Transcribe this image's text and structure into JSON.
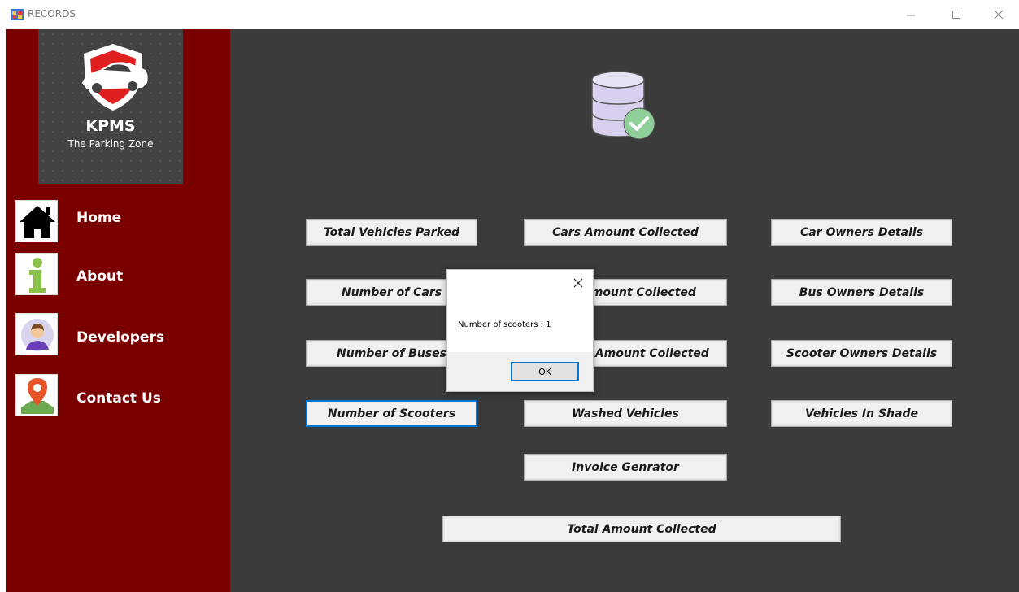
{
  "window": {
    "title": "RECORDS"
  },
  "logo": {
    "title": "KPMS",
    "subtitle": "The Parking Zone"
  },
  "nav": {
    "items": [
      {
        "label": "Home",
        "icon": "home-icon"
      },
      {
        "label": "About",
        "icon": "info-icon"
      },
      {
        "label": "Developers",
        "icon": "developer-avatar-icon"
      },
      {
        "label": "Contact Us",
        "icon": "location-pin-icon"
      }
    ]
  },
  "buttons": {
    "total_vehicles_parked": "Total Vehicles Parked",
    "cars_amount_collected": "Cars Amount Collected",
    "car_owners_details": "Car Owners Details",
    "number_of_cars": "Number of Cars",
    "bus_amount_collected": "Bus Amount Collected",
    "bus_owners_details": "Bus Owners Details",
    "number_of_buses": "Number of Buses",
    "scooter_amount_collected": "Scooter Amount Collected",
    "scooter_owners_details": "Scooter Owners Details",
    "number_of_scooters": "Number of Scooters",
    "washed_vehicles": "Washed Vehicles",
    "vehicles_in_shade": "Vehicles In Shade",
    "invoice_generator": "Invoice Genrator",
    "total_amount_collected": "Total Amount Collected"
  },
  "dialog": {
    "message": "Number of scooters : 1",
    "ok_label": "OK"
  },
  "colors": {
    "sidebar": "#7a0000",
    "main_bg": "#3b3b3b",
    "focus": "#0078d7"
  }
}
